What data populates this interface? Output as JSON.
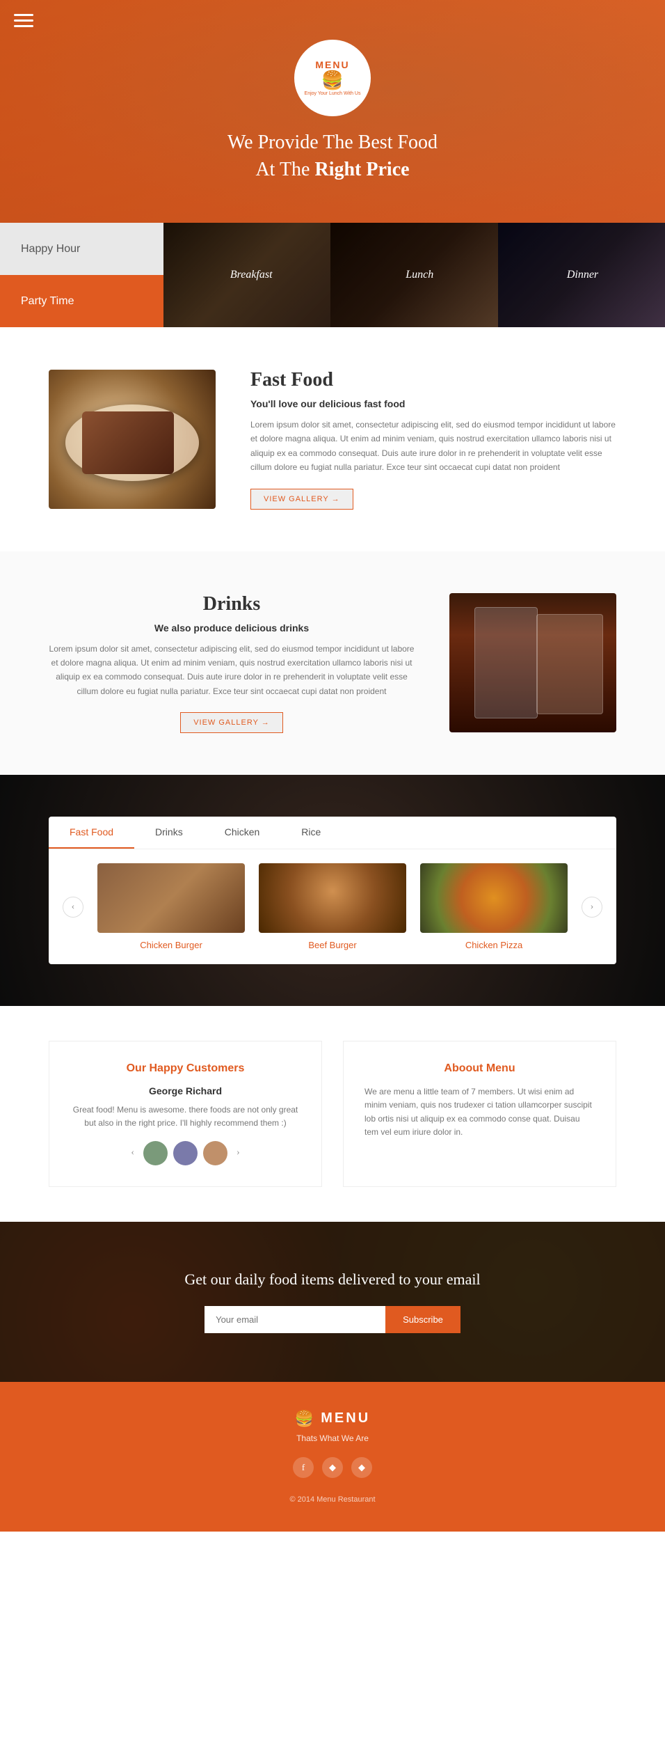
{
  "hero": {
    "logo_title": "MENU",
    "logo_tagline": "Enjoy Your Lunch With Us",
    "headline": "We Provide The Best Food",
    "subheadline_normal": "At The ",
    "subheadline_bold": "Right Price"
  },
  "nav": {
    "left_tabs": [
      {
        "id": "happy-hour",
        "label": "Happy Hour",
        "active": false
      },
      {
        "id": "party-time",
        "label": "Party Time",
        "active": true
      }
    ],
    "right_tabs": [
      {
        "id": "breakfast",
        "label": "Breakfast"
      },
      {
        "id": "lunch",
        "label": "Lunch"
      },
      {
        "id": "dinner",
        "label": "Dinner"
      }
    ]
  },
  "fast_food": {
    "title": "Fast Food",
    "subtitle": "You'll love our delicious fast food",
    "description": "Lorem ipsum dolor sit amet, consectetur adipiscing elit, sed do eiusmod tempor incididunt ut labore et dolore magna aliqua. Ut enim ad minim veniam, quis nostrud exercitation ullamco laboris nisi ut aliquip ex ea commodo consequat. Duis aute irure dolor in re prehenderit in voluptate velit esse cillum dolore eu fugiat nulla pariatur. Exce teur sint occaecat cupi datat non proident",
    "btn_label": "VIEW GALLERY"
  },
  "drinks": {
    "title": "Drinks",
    "subtitle": "We also produce delicious drinks",
    "description": "Lorem ipsum dolor sit amet, consectetur adipiscing elit, sed do eiusmod tempor incididunt ut labore et dolore magna aliqua. Ut enim ad minim veniam, quis nostrud exercitation ullamco laboris nisi ut aliquip ex ea commodo consequat. Duis aute irure dolor in re prehenderit in voluptate velit esse cillum dolore eu fugiat nulla pariatur. Exce teur sint occaecat cupi datat non proident",
    "btn_label": "VIEW GALLERY"
  },
  "menu_tabs": {
    "tabs": [
      {
        "id": "fast-food",
        "label": "Fast Food",
        "active": true
      },
      {
        "id": "drinks",
        "label": "Drinks",
        "active": false
      },
      {
        "id": "chicken",
        "label": "Chicken",
        "active": false
      },
      {
        "id": "rice",
        "label": "Rice",
        "active": false
      }
    ],
    "items": [
      {
        "id": "chicken-burger",
        "label": "Chicken Burger",
        "img_class": "img-chicken-burger"
      },
      {
        "id": "beef-burger",
        "label": "Beef Burger",
        "img_class": "img-beef-burger"
      },
      {
        "id": "chicken-pizza",
        "label": "Chicken Pizza",
        "img_class": "img-chicken-pizza"
      }
    ],
    "prev_btn": "‹",
    "next_btn": "›"
  },
  "testimonial": {
    "title": "Our Happy Customers",
    "reviewer": "George Richard",
    "review": "Great food! Menu is awesome. there foods are not only great but also in the right price. I'll highly recommend them :)",
    "prev": "‹",
    "next": "›"
  },
  "about": {
    "title": "Aboout Menu",
    "text": "We are menu a little team of 7 members. Ut wisi enim ad minim veniam, quis nos trudexer ci tation ullamcorper suscipit lob ortis nisi ut aliquip ex ea commodo conse quat. Duisau tem vel eum iriure dolor in."
  },
  "email": {
    "headline": "Get our daily food items delivered to your email",
    "placeholder": "Your email",
    "btn_label": "Subscribe"
  },
  "footer": {
    "logo_icon": "🍔",
    "logo_text": "MENU",
    "tagline": "Thats What We Are",
    "social": [
      {
        "id": "facebook",
        "icon": "f"
      },
      {
        "id": "diamond",
        "icon": "◆"
      },
      {
        "id": "diamond2",
        "icon": "◆"
      }
    ],
    "copyright": "© 2014 Menu Restaurant"
  },
  "colors": {
    "primary": "#e05a20",
    "dark": "#1a1a1a",
    "light_gray": "#f0f0f0"
  }
}
